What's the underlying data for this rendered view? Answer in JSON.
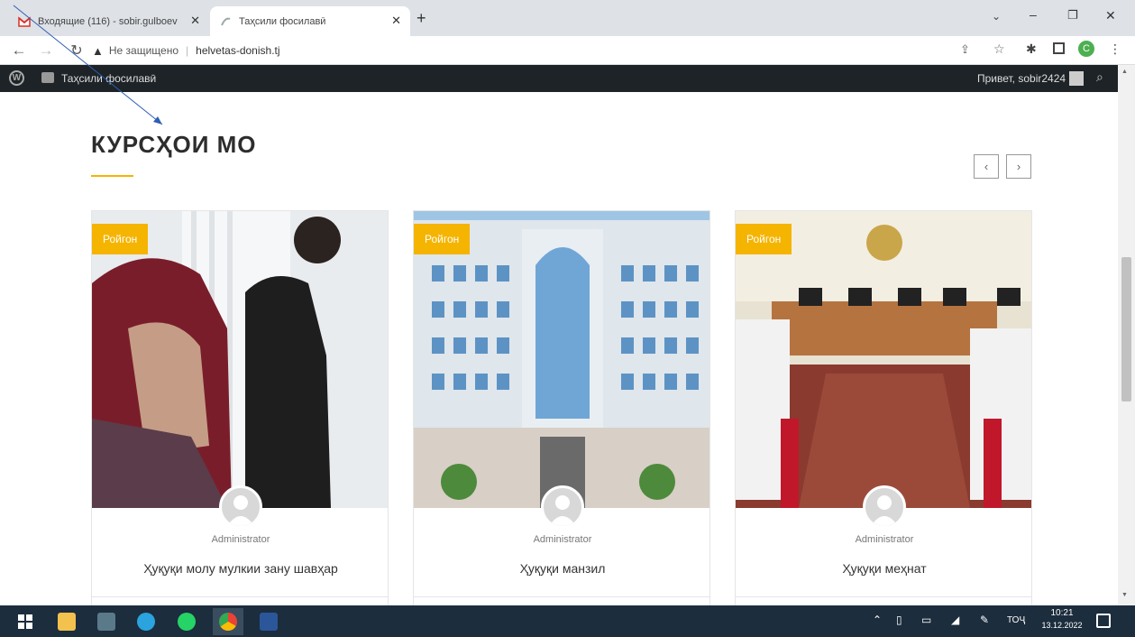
{
  "browser": {
    "tabs": [
      {
        "title": "Входящие (116) - sobir.gulboev"
      },
      {
        "title": "Таҳсили фосилавӣ"
      }
    ],
    "security_label": "Не защищено",
    "url": "helvetas-donish.tj",
    "profile_initial": "C"
  },
  "wp_admin_bar": {
    "site_name": "Таҳсили фосилавӣ",
    "greeting": "Привет, sobir2424"
  },
  "section": {
    "heading": "КУРСҲОИ МО"
  },
  "courses": [
    {
      "badge": "Ройгон",
      "author": "Administrator",
      "title": "Ҳуқуқи молу мулкии зану шавҳар"
    },
    {
      "badge": "Ройгон",
      "author": "Administrator",
      "title": "Ҳуқуқи манзил"
    },
    {
      "badge": "Ройгон",
      "author": "Administrator",
      "title": "Ҳуқуқи меҳнат"
    }
  ],
  "taskbar": {
    "lang": "ТОҶ",
    "time": "10:21",
    "date": "13.12.2022"
  }
}
